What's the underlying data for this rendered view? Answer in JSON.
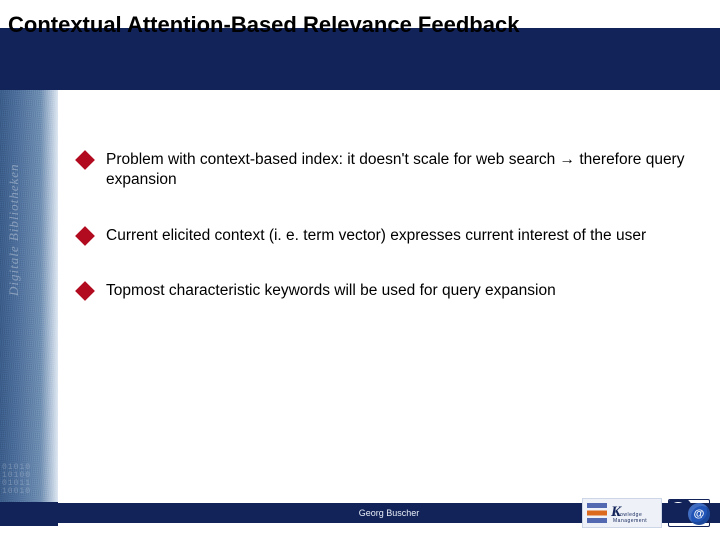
{
  "title": "Contextual Attention-Based Relevance Feedback",
  "bullets": {
    "b1": "Problem with context-based index: it doesn't scale for web search → therefore query expansion",
    "b2": "Current elicited context (i. e. term vector) expresses current interest of the user",
    "b3": "Topmost characteristic keywords will be used for query expansion"
  },
  "footer": {
    "author": "Georg Buscher"
  },
  "sidebar": {
    "vertical_text": "Digitale Bibliotheken",
    "binary": "01010\n10100\n01011\n10010"
  },
  "logo": {
    "brand_short": "K",
    "brand_sub": "Knowledge Management",
    "at": "@"
  }
}
